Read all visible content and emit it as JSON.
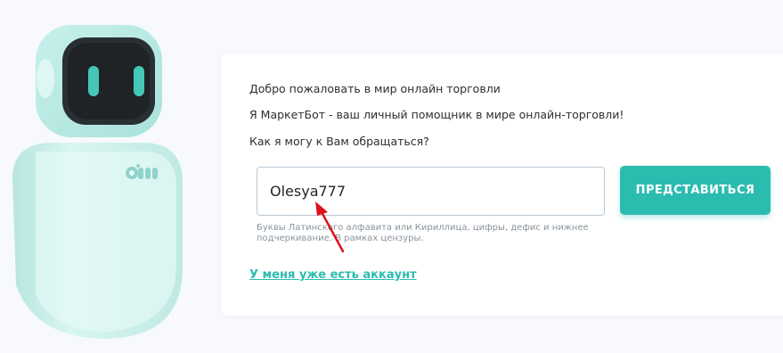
{
  "greeting": {
    "welcome": "Добро пожаловать в мир онлайн торговли",
    "intro": "Я МаркетБот - ваш личный помощник в мире онлайн-торговли!",
    "question": "Как я могу к Вам обращаться?"
  },
  "name_input": {
    "value": "Olesya777"
  },
  "submit_button": {
    "label": "ПРЕДСТАВИТЬСЯ"
  },
  "hint": {
    "text": "Буквы Латинского алфавита или Кириллица, цифры, дефис и нижнее подчеркивание. В рамках цензуры."
  },
  "login_link": {
    "label": "У меня уже есть аккаунт"
  },
  "colors": {
    "accent": "#2bbcb0",
    "annotation_arrow": "#e0101a",
    "robot_body": "#cdf0ec",
    "robot_face": "#1f2326"
  },
  "icons": {
    "mascot": "robot-mascot",
    "annotation": "arrow-pointer"
  }
}
